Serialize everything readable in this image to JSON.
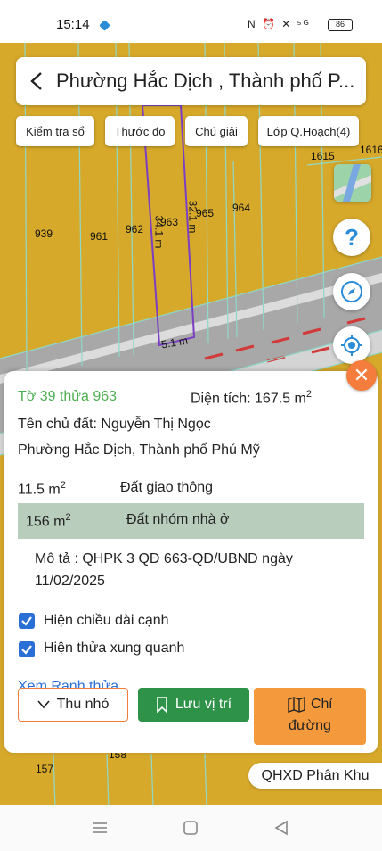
{
  "status": {
    "time": "15:14",
    "icons": "N ⏰ ✕ ⁵ᴳ",
    "battery": "86"
  },
  "header": {
    "title": "Phường Hắc Dịch , Thành phố P..."
  },
  "toolbar": [
    {
      "label": "Kiểm tra sổ"
    },
    {
      "label": "Thước đo"
    },
    {
      "label": "Chú giải"
    },
    {
      "label": "Lớp Q.Hoạch(4)"
    }
  ],
  "map": {
    "parcels": [
      "1615",
      "1616",
      "939",
      "961",
      "962",
      "963",
      "965",
      "964",
      "157",
      "158"
    ],
    "lengths": [
      "34.1 m",
      "32.1 m",
      "5.1 m"
    ],
    "colors": {
      "residential": "#d7a92b",
      "road": "#a9a9a9",
      "parcel_line": "#8fd8c8",
      "highlight": "#7b3fc4"
    }
  },
  "side_buttons": {
    "help": "?"
  },
  "panel": {
    "parcel_id": "Tờ 39 thửa 963",
    "area_label": "Diện tích: 167.5 m",
    "area_sup": "2",
    "owner": "Tên chủ đất: Nguyễn Thị Ngọc",
    "address": "Phường Hắc Dịch, Thành phố Phú Mỹ",
    "land_uses": [
      {
        "area": "11.5 m",
        "sup": "2",
        "type": "Đất giao thông"
      },
      {
        "area": "156 m",
        "sup": "2",
        "type": "Đất nhóm nhà ở"
      }
    ],
    "description": "Mô tả : QHPK 3 QĐ 663-QĐ/UBND ngày",
    "description_date": "11/02/2025",
    "checkbox_edges": "Hiện chiều dài cạnh",
    "checkbox_neighbors": "Hiện thửa xung quanh",
    "link": "Xem Ranh thửa",
    "btn_shrink": "Thu nhỏ",
    "btn_save": "Lưu vị trí",
    "btn_route_1": "Chỉ",
    "btn_route_2": "đường"
  },
  "bottom_chip": "QHXD Phân Khu"
}
